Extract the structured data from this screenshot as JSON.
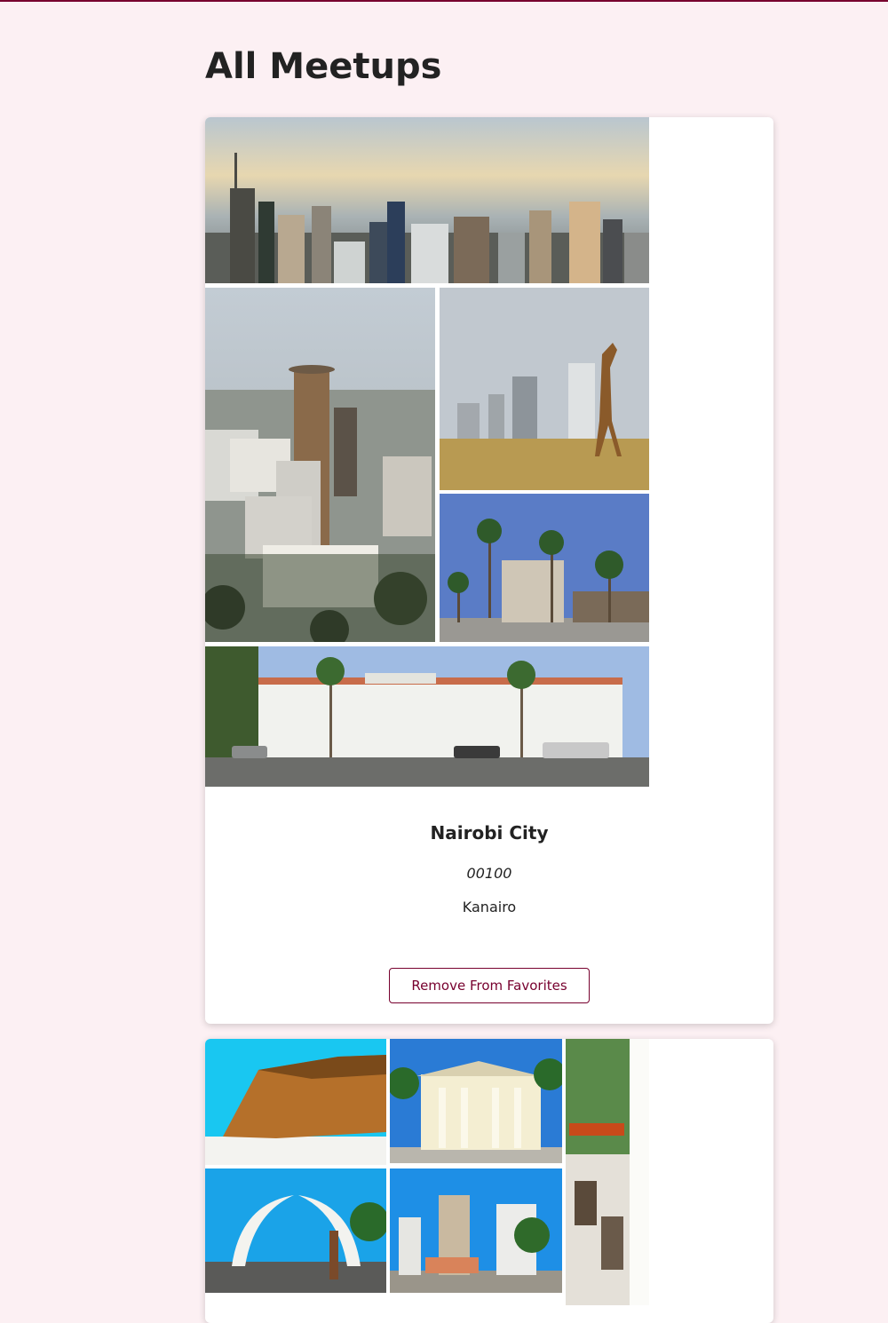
{
  "page": {
    "title": "All Meetups",
    "accent_color": "#77002e",
    "background_color": "#fcf0f3"
  },
  "meetups": [
    {
      "title": "Nairobi City",
      "code": "00100",
      "description": "Kanairo",
      "favorite_button_label": "Remove From Favorites",
      "image_collage": [
        "city-skyline-photo",
        "kicc-tower-photo",
        "giraffe-skyline-photo",
        "palm-building-photo",
        "city-hall-photo"
      ]
    },
    {
      "image_collage": [
        "fort-jesus-photo",
        "colonial-building-photo",
        "street-balcony-photo",
        "tusks-arch-photo",
        "city-buildings-photo"
      ]
    }
  ]
}
